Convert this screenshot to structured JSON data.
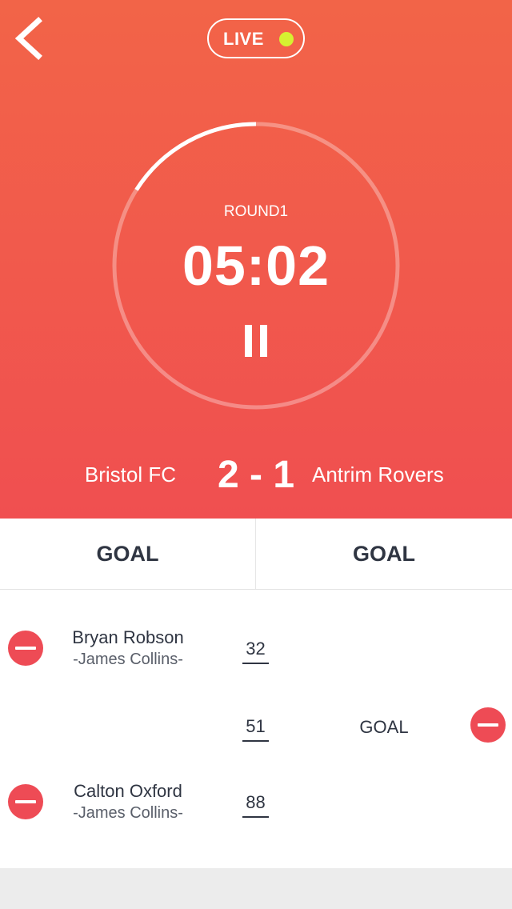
{
  "header": {
    "back_icon": "chevron-left-icon",
    "live_label": "LIVE",
    "live_dot_color": "#d6f031"
  },
  "timer": {
    "round_label": "ROUND1",
    "time": "05:02",
    "progress_fraction": 0.16,
    "pause_icon": "pause-icon"
  },
  "match": {
    "home_team": "Bristol FC",
    "score": "2 - 1",
    "away_team": "Antrim Rovers"
  },
  "tabs": [
    {
      "label": "GOAL"
    },
    {
      "label": "GOAL"
    }
  ],
  "events": [
    {
      "side": "home",
      "player": "Bryan Robson",
      "assist": "-James Collins-",
      "minute": "32"
    },
    {
      "side": "away",
      "label": "GOAL",
      "minute": "51"
    },
    {
      "side": "home",
      "player": "Calton Oxford",
      "assist": "-James Collins-",
      "minute": "88"
    }
  ],
  "colors": {
    "hero_top": "#f26448",
    "hero_bottom": "#f04f50",
    "remove_button": "#ee4b55",
    "text_dark": "#2f3542"
  }
}
